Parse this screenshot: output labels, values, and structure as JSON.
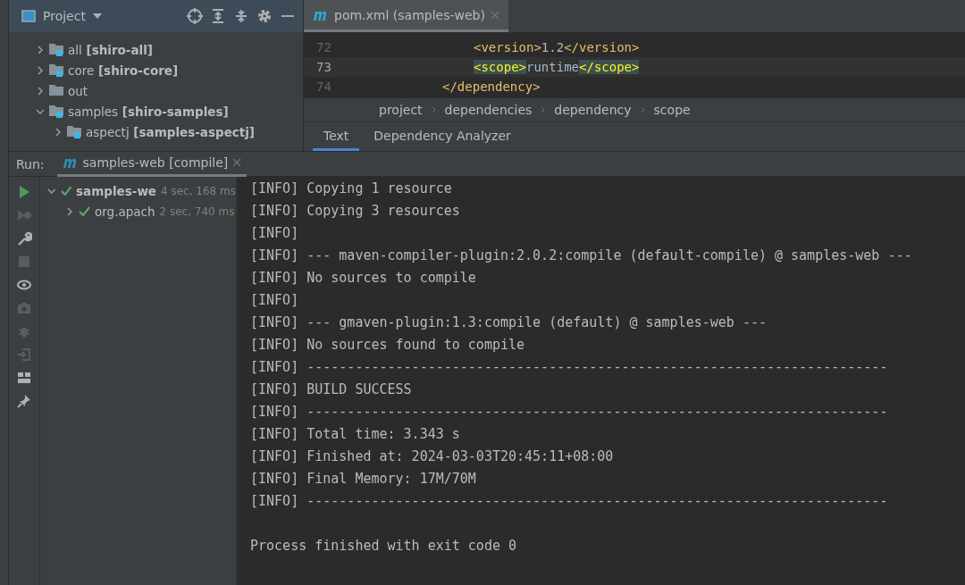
{
  "project_panel": {
    "title": "Project",
    "tree": [
      {
        "name": "all",
        "module": "[shiro-all]",
        "expanded": false
      },
      {
        "name": "core",
        "module": "[shiro-core]",
        "expanded": false
      },
      {
        "name": "out",
        "expanded": false
      },
      {
        "name": "samples",
        "module": "[shiro-samples]",
        "expanded": true,
        "children": [
          {
            "name": "aspectj",
            "module": "[samples-aspectj]",
            "expanded": false
          }
        ]
      }
    ]
  },
  "editor": {
    "tab": "pom.xml (samples-web)",
    "lines": [
      {
        "number": "72",
        "kind": "child",
        "current": false,
        "code": [
          {
            "kind": "tag",
            "text": "<version>",
            "matched": false
          },
          {
            "kind": "text",
            "text": "1.2"
          },
          {
            "kind": "tag",
            "text": "</version>",
            "matched": false
          }
        ]
      },
      {
        "number": "73",
        "kind": "child",
        "current": true,
        "code": [
          {
            "kind": "tag",
            "text": "<scope>",
            "matched": true
          },
          {
            "kind": "text",
            "text": "runtime"
          },
          {
            "kind": "tag",
            "text": "</scope>",
            "matched": true
          }
        ]
      },
      {
        "number": "74",
        "kind": "parent",
        "current": false,
        "code": [
          {
            "kind": "tag",
            "text": "</dependency>",
            "matched": false
          }
        ]
      }
    ],
    "breadcrumbs": [
      "project",
      "dependencies",
      "dependency",
      "scope"
    ],
    "tabs": [
      {
        "label": "Text",
        "selected": true
      },
      {
        "label": "Dependency Analyzer",
        "selected": false
      }
    ]
  },
  "run": {
    "label": "Run:",
    "tab": "samples-web [compile]",
    "tools": [
      {
        "kind": "run",
        "disabled": false
      },
      {
        "kind": "rerun",
        "disabled": true
      },
      {
        "kind": "wrench",
        "disabled": false
      },
      {
        "kind": "stop",
        "disabled": true
      },
      {
        "kind": "eye",
        "disabled": false
      },
      {
        "kind": "camera",
        "disabled": true
      },
      {
        "kind": "bug",
        "disabled": true
      },
      {
        "kind": "enter",
        "disabled": true
      },
      {
        "kind": "layout",
        "disabled": false
      },
      {
        "kind": "pin",
        "disabled": false
      }
    ],
    "tree": [
      {
        "name": "samples-we",
        "time": "4 sec, 168 ms",
        "expanded": true,
        "children": [
          {
            "name": "org.apach",
            "time": "2 sec, 740 ms",
            "expanded": false
          }
        ]
      }
    ],
    "console": [
      "[INFO] Copying 1 resource",
      "[INFO] Copying 3 resources",
      "[INFO]",
      "[INFO] --- maven-compiler-plugin:2.0.2:compile (default-compile) @ samples-web ---",
      "[INFO] No sources to compile",
      "[INFO]",
      "[INFO] --- gmaven-plugin:1.3:compile (default) @ samples-web ---",
      "[INFO] No sources found to compile",
      "[INFO] ------------------------------------------------------------------------",
      "[INFO] BUILD SUCCESS",
      "[INFO] ------------------------------------------------------------------------",
      "[INFO] Total time: 3.343 s",
      "[INFO] Finished at: 2024-03-03T20:45:11+08:00",
      "[INFO] Final Memory: 17M/70M",
      "[INFO] ------------------------------------------------------------------------"
    ],
    "exit_message": "Process finished with exit code 0"
  }
}
